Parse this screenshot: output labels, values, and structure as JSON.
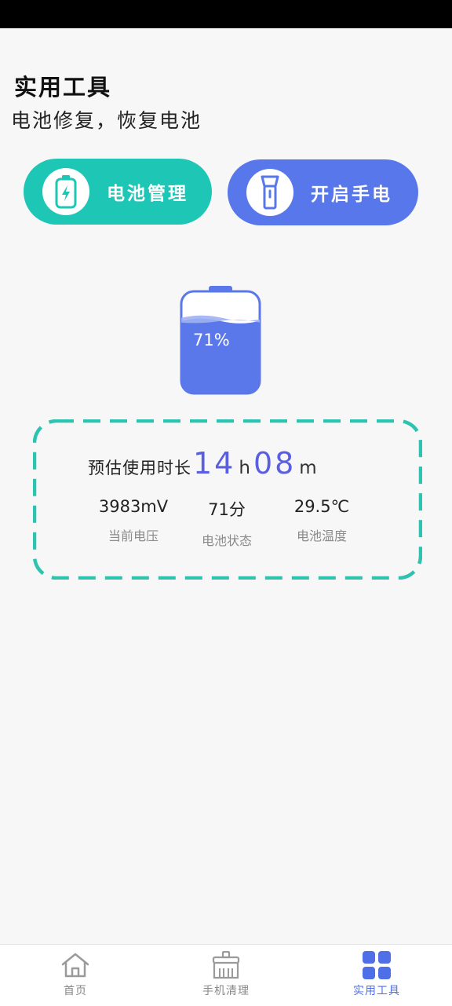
{
  "header": {
    "title": "实用工具",
    "subtitle": "电池修复，恢复电池"
  },
  "actions": {
    "battery_manage": "电池管理",
    "flashlight": "开启手电"
  },
  "battery": {
    "percent_label": "71%",
    "level": 0.71
  },
  "estimate": {
    "label": "预估使用时长",
    "hours": "14",
    "hours_unit": "h",
    "minutes": "08",
    "minutes_unit": "m"
  },
  "stats": [
    {
      "value": "3983mV",
      "caption": "当前电压"
    },
    {
      "value": "71分",
      "caption": "电池状态"
    },
    {
      "value": "29.5℃",
      "caption": "电池温度"
    }
  ],
  "nav": [
    {
      "label": "首页",
      "icon": "home-icon"
    },
    {
      "label": "手机清理",
      "icon": "broom-icon"
    },
    {
      "label": "实用工具",
      "icon": "grid-icon"
    }
  ],
  "colors": {
    "teal": "#1ec6b6",
    "blue": "#5777ea",
    "battery_fill": "#5b78ea",
    "accent_text": "#5a5fe0",
    "nav_active": "#4f6fe8"
  }
}
